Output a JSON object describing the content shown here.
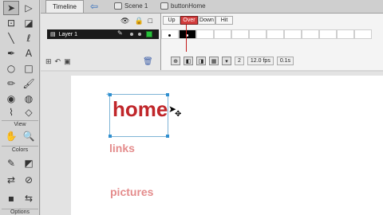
{
  "timeline": {
    "tab_label": "Timeline",
    "breadcrumb": [
      {
        "label": "Scene 1",
        "icon": "scene-icon"
      },
      {
        "label": "buttonHome",
        "icon": "button-symbol-icon"
      }
    ],
    "layer": {
      "name": "Layer 1"
    },
    "frame_labels": [
      "Up",
      "Over",
      "Down",
      "Hit"
    ],
    "active_frame_label": "Over",
    "current_frame": "2",
    "frame_rate": "12.0 fps",
    "elapsed": "0.1s"
  },
  "tools": {
    "view_label": "View",
    "colors_label": "Colors",
    "options_label": "Options"
  },
  "stage": {
    "words": [
      "home",
      "links",
      "pictures"
    ]
  },
  "colors": {
    "over_frame": "#d23c3c",
    "home_text": "#c0262a",
    "faded_text": "#e48c8c",
    "selection": "#2f8fd0"
  }
}
